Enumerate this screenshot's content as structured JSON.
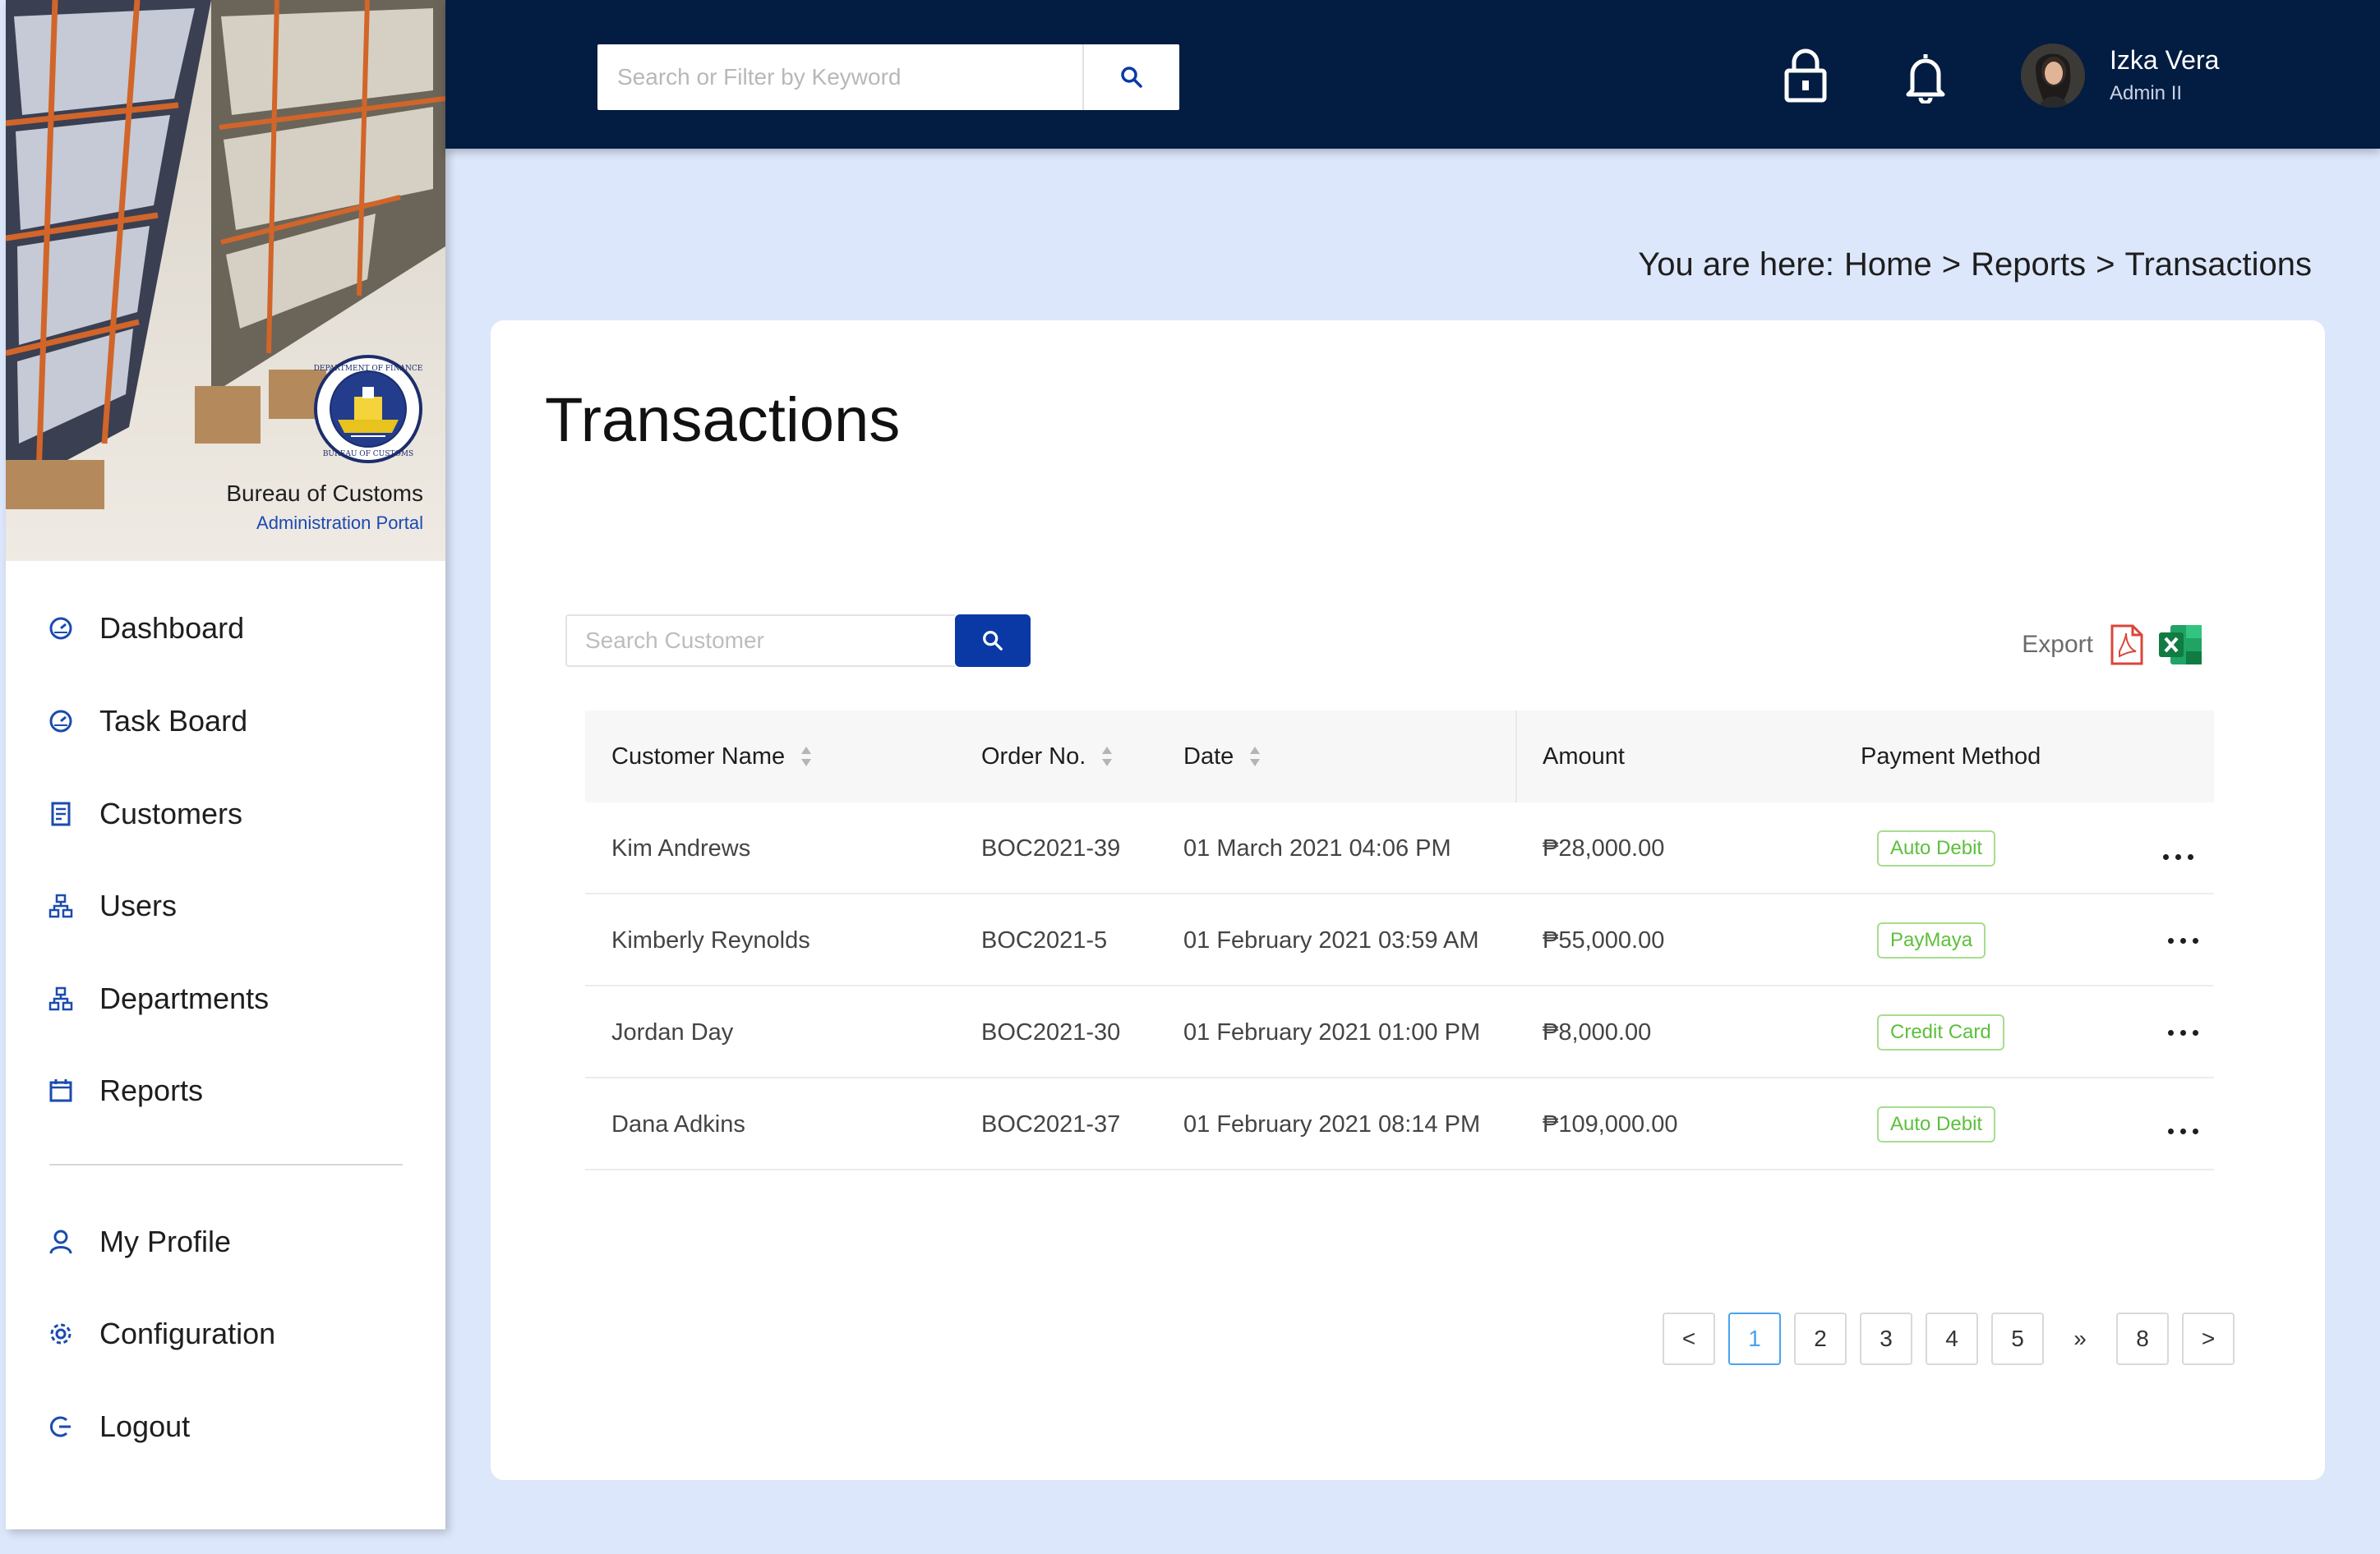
{
  "app": {
    "brand_title": "Bureau of Customs",
    "brand_subtitle": "Administration Portal"
  },
  "header": {
    "search_placeholder": "Search or Filter by Keyword",
    "user": {
      "name": "Izka Vera",
      "role": "Admin II"
    }
  },
  "sidebar": {
    "items": [
      {
        "label": "Dashboard",
        "icon": "dashboard-icon"
      },
      {
        "label": "Task Board",
        "icon": "dashboard-icon"
      },
      {
        "label": "Customers",
        "icon": "receipt-icon"
      },
      {
        "label": "Users",
        "icon": "org-chart-icon"
      },
      {
        "label": "Departments",
        "icon": "org-chart-icon"
      },
      {
        "label": "Reports",
        "icon": "calendar-icon"
      }
    ],
    "bottom_items": [
      {
        "label": "My Profile",
        "icon": "user-icon"
      },
      {
        "label": "Configuration",
        "icon": "gear-icon"
      },
      {
        "label": "Logout",
        "icon": "logout-icon"
      }
    ]
  },
  "breadcrumb": {
    "prefix": "You are here:",
    "items": [
      "Home",
      "Reports",
      "Transactions"
    ],
    "separator": ">"
  },
  "main": {
    "title": "Transactions",
    "search_placeholder": "Search Customer",
    "export_label": "Export",
    "columns": [
      "Customer Name",
      "Order No.",
      "Date",
      "Amount",
      "Payment Method"
    ],
    "rows": [
      {
        "customer": "Kim Andrews",
        "order": "BOC2021-39",
        "date": "01 March 2021 04:06 PM",
        "amount": "₱28,000.00",
        "method": "Auto Debit"
      },
      {
        "customer": "Kimberly Reynolds",
        "order": "BOC2021-5",
        "date": "01 February 2021 03:59 AM",
        "amount": "₱55,000.00",
        "method": "PayMaya"
      },
      {
        "customer": "Jordan Day",
        "order": "BOC2021-30",
        "date": "01 February 2021 01:00 PM",
        "amount": "₱8,000.00",
        "method": "Credit Card"
      },
      {
        "customer": "Dana Adkins",
        "order": "BOC2021-37",
        "date": "01 February 2021 08:14 PM",
        "amount": "₱109,000.00",
        "method": "Auto Debit"
      }
    ],
    "pagination": {
      "prev": "<",
      "pages": [
        "1",
        "2",
        "3",
        "4",
        "5"
      ],
      "jump": "»",
      "last": "8",
      "next": ">",
      "current": "1"
    }
  },
  "colors": {
    "topbar": "#031c42",
    "page_bg": "#dde7fb",
    "accent": "#0a39a5",
    "badge_green": "#5dbf3c",
    "active_page": "#4aa3f0"
  }
}
